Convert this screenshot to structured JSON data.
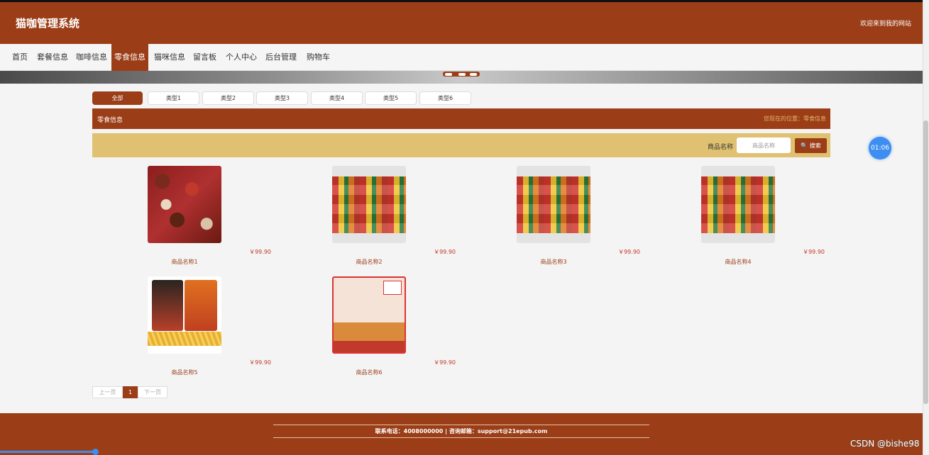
{
  "header": {
    "title": "猫咖管理系统",
    "welcome": "欢迎来到我的网站"
  },
  "nav": {
    "items": [
      {
        "label": "首页"
      },
      {
        "label": "套餐信息"
      },
      {
        "label": "咖啡信息"
      },
      {
        "label": "零食信息",
        "active": true
      },
      {
        "label": "猫咪信息"
      },
      {
        "label": "留言板"
      },
      {
        "label": "个人中心"
      },
      {
        "label": "后台管理"
      },
      {
        "label": "购物车"
      }
    ]
  },
  "filters": {
    "items": [
      {
        "label": "全部",
        "active": true
      },
      {
        "label": "类型1"
      },
      {
        "label": "类型2"
      },
      {
        "label": "类型3"
      },
      {
        "label": "类型4"
      },
      {
        "label": "类型5"
      },
      {
        "label": "类型6"
      }
    ]
  },
  "section": {
    "title": "零食信息",
    "location": "您现在的位置：零食信息"
  },
  "search": {
    "label": "商品名称",
    "placeholder": "商品名称",
    "button": "搜索"
  },
  "products": [
    {
      "name": "商品名称1",
      "price": "￥99.90",
      "image": "chocolates"
    },
    {
      "name": "商品名称2",
      "price": "￥99.90",
      "image": "chips-assortment"
    },
    {
      "name": "商品名称3",
      "price": "￥99.90",
      "image": "chips-assortment"
    },
    {
      "name": "商品名称4",
      "price": "￥99.90",
      "image": "chips-assortment"
    },
    {
      "name": "商品名称5",
      "price": "￥99.90",
      "image": "shrimp-sticks"
    },
    {
      "name": "商品名称6",
      "price": "￥99.90",
      "image": "rice-crisps"
    }
  ],
  "pagination": {
    "prev": "上一页",
    "current": "1",
    "next": "下一页"
  },
  "timer": "01:06",
  "footer": {
    "contact": "联系电话：4008000000 | 咨询邮箱：support@21epub.com"
  },
  "watermark": "CSDN @bishe98",
  "colors": {
    "brand": "#9b3e17",
    "search_bar": "#dfc171",
    "price": "#c0392b",
    "timer": "#3d8ef0"
  }
}
